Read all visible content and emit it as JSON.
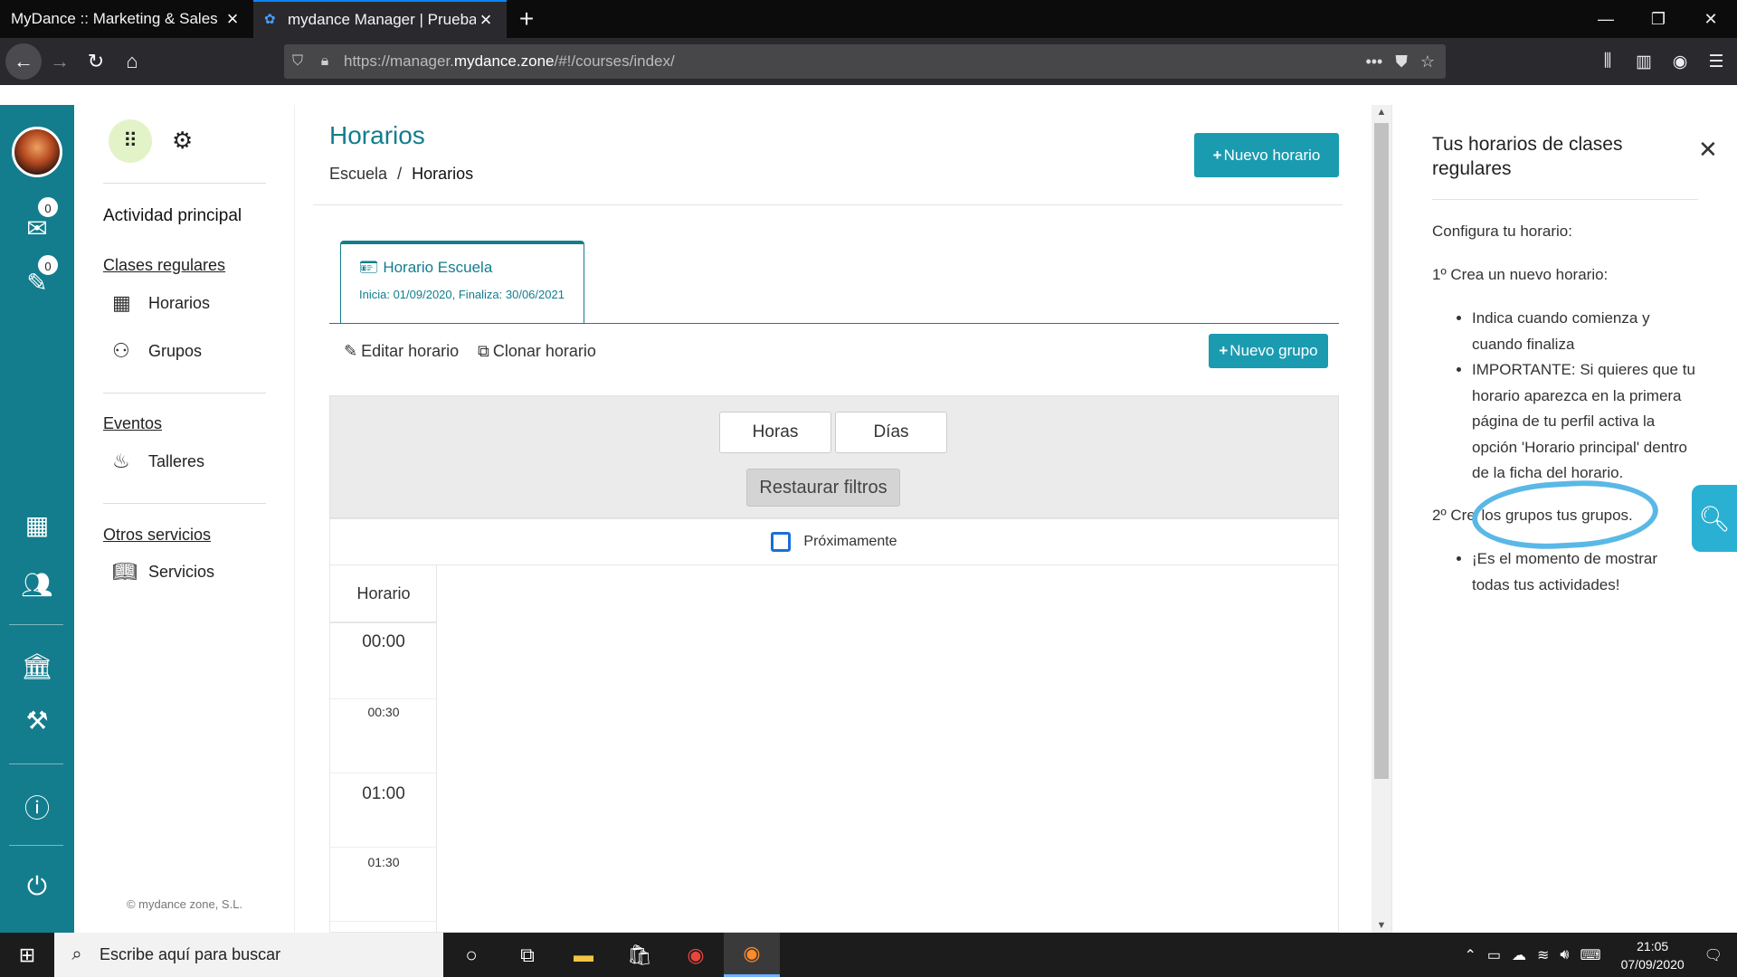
{
  "browser": {
    "tabs": [
      {
        "title": "MyDance :: Marketing & Sales",
        "active": false
      },
      {
        "title": "mydance Manager | Prueba Ale",
        "active": true
      }
    ],
    "url_prefix": "https://manager.",
    "url_domain": "mydance.zone",
    "url_path": "/#!/courses/index/"
  },
  "leftbar": {
    "mail_count": "0",
    "tasks_count": "0"
  },
  "sidebar": {
    "main_activity": "Actividad principal",
    "section_regular": "Clases regulares",
    "item_schedules": "Horarios",
    "item_groups": "Grupos",
    "section_events": "Eventos",
    "item_workshops": "Talleres",
    "section_other": "Otros servicios",
    "item_services": "Servicios",
    "copyright": "© mydance zone, S.L."
  },
  "main": {
    "title": "Horarios",
    "breadcrumb_root": "Escuela",
    "breadcrumb_sep": "/",
    "breadcrumb_current": "Horarios",
    "new_schedule_button": "Nuevo horario",
    "schedule_tab": {
      "name": "Horario Escuela",
      "dates": "Inicia: 01/09/2020, Finaliza: 30/06/2021"
    },
    "edit_schedule": "Editar horario",
    "clone_schedule": "Clonar horario",
    "new_group_button": "Nuevo grupo",
    "filter_hours": "Horas",
    "filter_days": "Días",
    "restore_filters": "Restaurar filtros",
    "upcoming_label": "Próximamente",
    "grid_header": "Horario",
    "time_slots": [
      "00:00",
      "00:30",
      "01:00",
      "01:30"
    ]
  },
  "help_panel": {
    "title": "Tus horarios de clases regulares",
    "intro": "Configura tu horario:",
    "step1_title": "1º Crea un nuevo horario:",
    "step1_items": [
      "Indica cuando comienza y cuando finaliza",
      "IMPORTANTE: Si quieres que tu horario aparezca en la primera página de tu perfil activa la opción 'Horario principal' dentro de la ficha del horario."
    ],
    "step2_prefix": "2º Cre",
    "step2_highlight": "los grupos tus grupos.",
    "step2_items": [
      "¡Es el momento de mostrar todas tus actividades!"
    ]
  },
  "taskbar": {
    "search_placeholder": "Escribe aquí para buscar",
    "time": "21:05",
    "date": "07/09/2020"
  },
  "colors": {
    "brand_teal": "#137d8e",
    "button_teal": "#1a9bb0",
    "annotation_blue": "#5ab8e6"
  }
}
